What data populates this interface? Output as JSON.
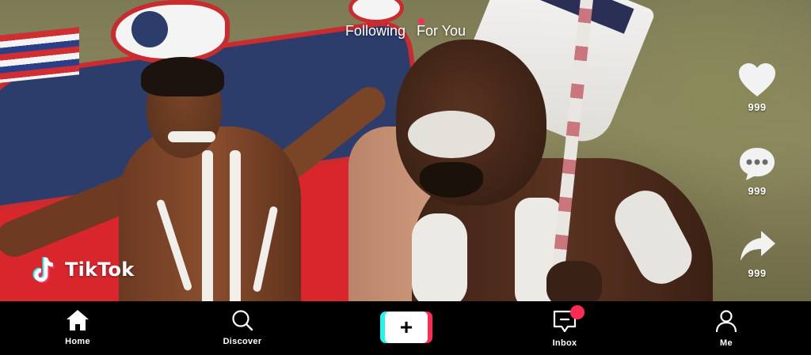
{
  "top_tabs": [
    {
      "label": "Following"
    },
    {
      "label": "For You"
    }
  ],
  "actions": {
    "like": {
      "icon": "heart-icon",
      "count": "999"
    },
    "comment": {
      "icon": "comment-icon",
      "count": "999"
    },
    "share": {
      "icon": "share-icon",
      "count": "999"
    }
  },
  "brand": {
    "name": "TikTok",
    "icon": "tiktok-logo-icon"
  },
  "bottom_nav": [
    {
      "label": "Home",
      "icon": "home-icon"
    },
    {
      "label": "Discover",
      "icon": "search-icon"
    },
    {
      "label": "+",
      "icon": "create-icon"
    },
    {
      "label": "Inbox",
      "icon": "inbox-icon"
    },
    {
      "label": "Me",
      "icon": "profile-icon"
    }
  ],
  "colors": {
    "accent_pink": "#fe2c55",
    "accent_cyan": "#25f4ee",
    "nav_background": "#000000",
    "text": "#ffffff"
  }
}
